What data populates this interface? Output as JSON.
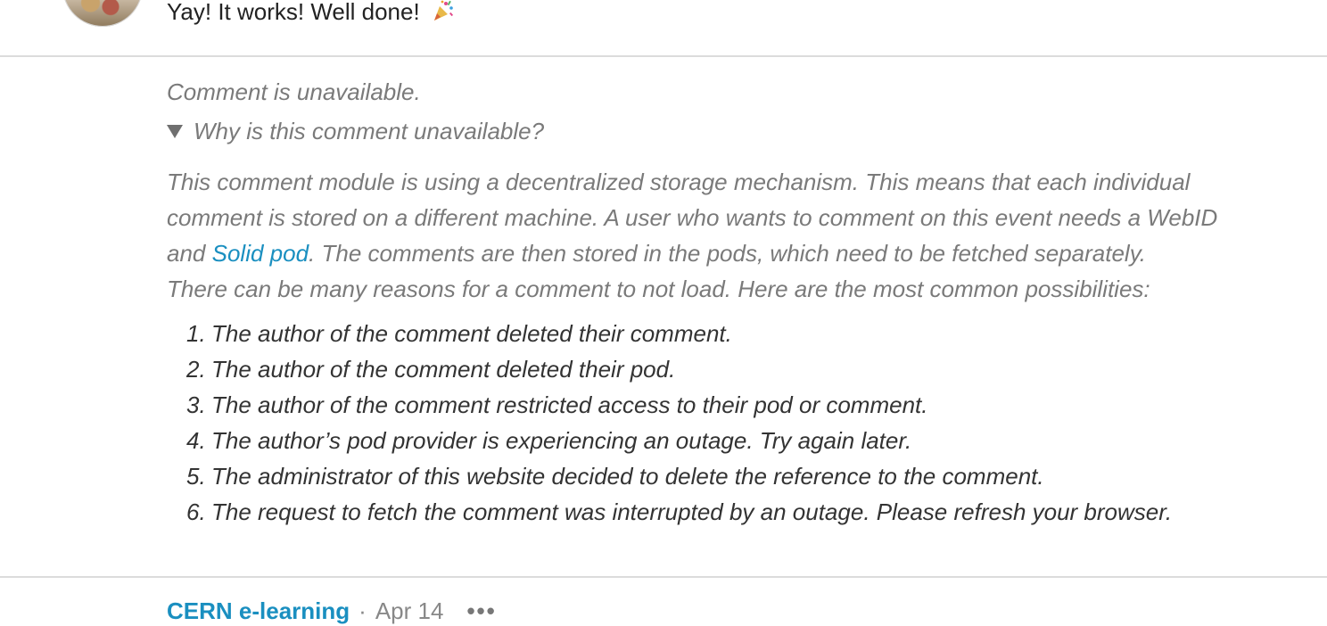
{
  "previous_comment": {
    "text": "Yay! It works! Well done!",
    "emoji_icon": "party-popper-icon"
  },
  "unavailable_comment": {
    "title": "Comment is unavailable.",
    "why_toggle": "Why is this comment unavailable?",
    "explanation_before_link": "This comment module is using a decentralized storage mechanism. This means that each individual comment is stored on a different machine. A user who wants to comment on this event needs a WebID and ",
    "link_text": "Solid pod",
    "explanation_after_link": ". The comments are then stored in the pods, which need to be fetched separately.",
    "reasons_intro": "There can be many reasons for a comment to not load. Here are the most common possibilities:",
    "reasons": [
      {
        "num": "1.",
        "text": "The author of the comment deleted their comment."
      },
      {
        "num": "2.",
        "text": "The author of the comment deleted their pod."
      },
      {
        "num": "3.",
        "text": "The author of the comment restricted access to their pod or comment."
      },
      {
        "num": "4.",
        "text": "The author’s pod provider is experiencing an outage. Try again later."
      },
      {
        "num": "5.",
        "text": "The administrator of this website decided to delete the reference to the comment."
      },
      {
        "num": "6.",
        "text": "The request to fetch the comment was interrupted by an outage. Please refresh your browser."
      }
    ]
  },
  "next_comment": {
    "author": "CERN e-learning",
    "separator": "·",
    "date": "Apr 14",
    "more_label": "•••"
  },
  "colors": {
    "link": "#1a8fc0",
    "muted_text": "#7a7a7a",
    "divider": "#dcdcdc"
  }
}
